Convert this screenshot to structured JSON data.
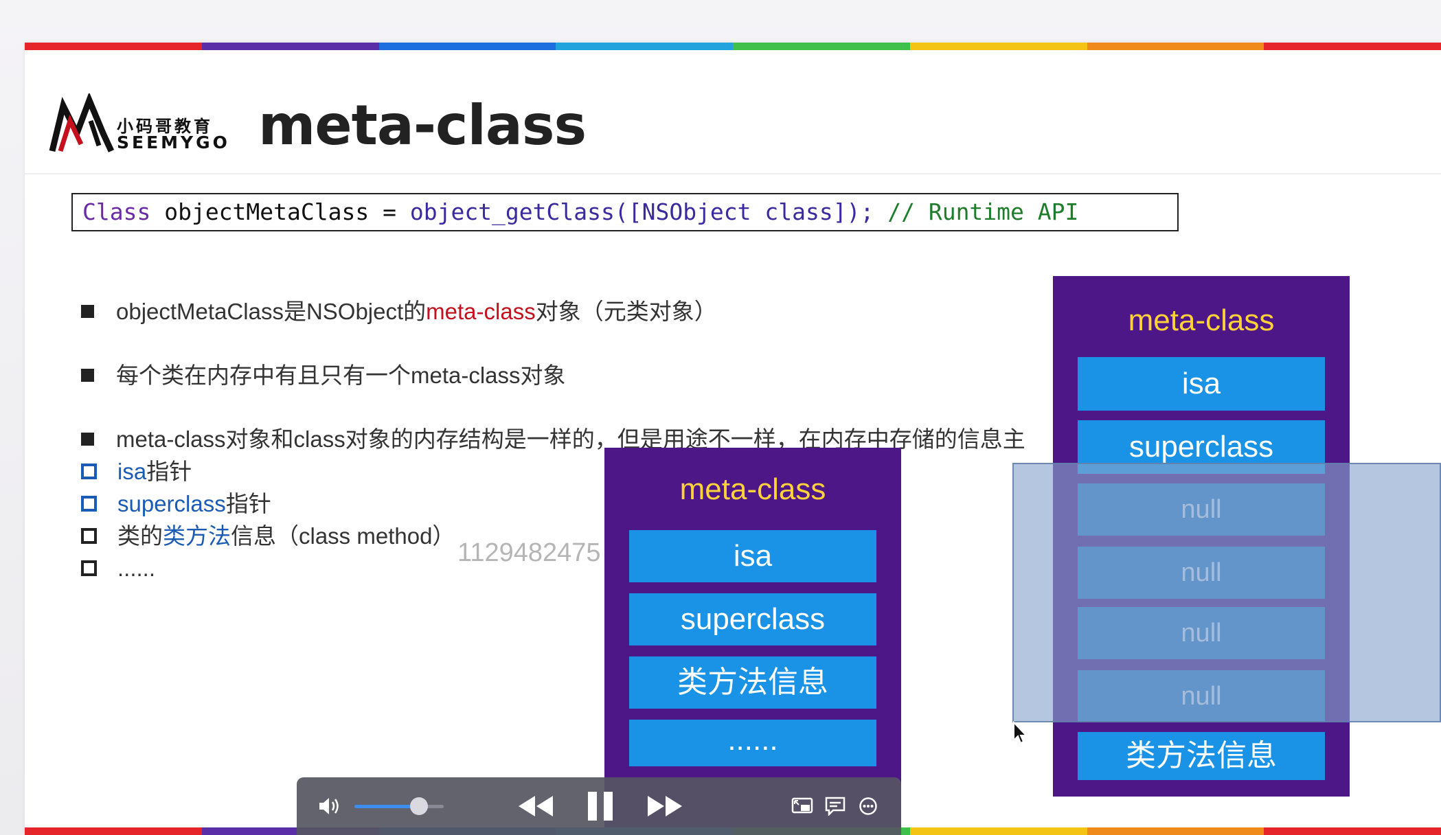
{
  "slide": {
    "title": "meta-class",
    "logo": {
      "cn_text": "小码哥教育",
      "en_text": "SEEMYGO"
    },
    "rainbow_colors": [
      "#e6252b",
      "#5a2ea6",
      "#1d6fe0",
      "#22a3dd",
      "#3ec04a",
      "#f4c414",
      "#f08a1a",
      "#e6252b"
    ],
    "code_line": {
      "keyword": "Class",
      "variable": " objectMetaClass = ",
      "function": "object_getClass([NSObject class]);",
      "comment": " // Runtime API"
    },
    "bullets": {
      "b1_prefix": "objectMetaClass是NSObject的",
      "b1_highlight": "meta-class",
      "b1_suffix": "对象（元类对象）",
      "b2": "每个类在内存中有且只有一个meta-class对象",
      "b3": "meta-class对象和class对象的内存结构是一样的，但是用途不一样，在内存中存储的信息主",
      "sub1_highlight": "isa",
      "sub1_suffix": "指针",
      "sub2_highlight": "superclass",
      "sub2_suffix": "指针",
      "sub3_prefix": "类的",
      "sub3_highlight": "类方法",
      "sub3_suffix": "信息（class method）",
      "sub4": "......"
    },
    "watermark": "1129482475",
    "panel_small": {
      "title": "meta-class",
      "cells": [
        "isa",
        "superclass",
        "类方法信息",
        "......"
      ]
    },
    "panel_large": {
      "title": "meta-class",
      "cells": [
        "isa",
        "superclass",
        "null",
        "null",
        "null",
        "null",
        "类方法信息"
      ]
    },
    "colors": {
      "panel_bg": "#4d1787",
      "panel_title": "#ffd23a",
      "cell_bg": "#1a93e6",
      "highlight_red": "#c4111d",
      "highlight_blue": "#1a5bb5"
    }
  },
  "player": {
    "volume_fraction": 0.72,
    "icons": [
      "volume-icon",
      "rewind-icon",
      "pause-icon",
      "fast-forward-icon",
      "picture-in-picture-icon",
      "subtitles-icon",
      "more-options-icon"
    ]
  }
}
